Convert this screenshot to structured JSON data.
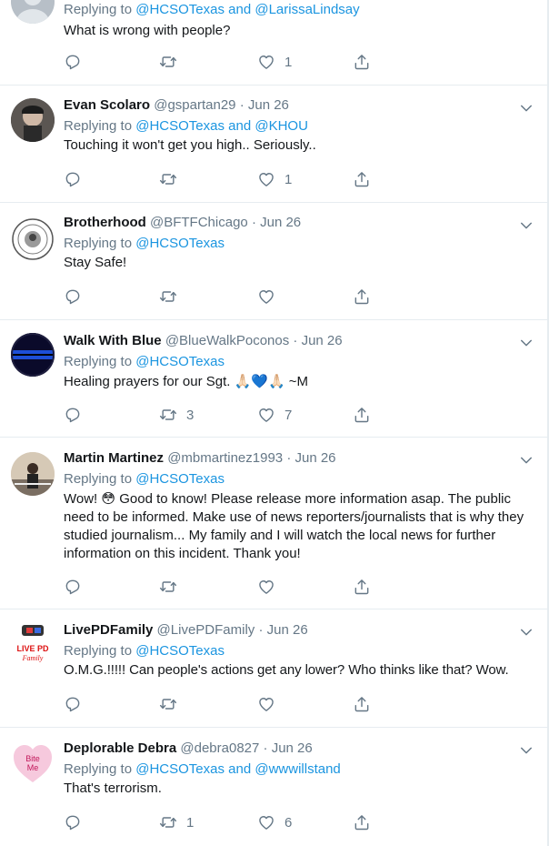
{
  "tweets": [
    {
      "name": "",
      "handle": "",
      "date": "",
      "reply_prefix": "Replying to",
      "reply_1": "@HCSOTexas",
      "reply_and": "and",
      "reply_2": "@LarissaLindsay",
      "text": "What is wrong with people?",
      "retweets": "",
      "likes": "1"
    },
    {
      "name": "Evan Scolaro",
      "handle": "@gspartan29",
      "sep": "·",
      "date": "Jun 26",
      "reply_prefix": "Replying to",
      "reply_1": "@HCSOTexas",
      "reply_and": "and",
      "reply_2": "@KHOU",
      "text": "Touching it won't get you high.. Seriously..",
      "retweets": "",
      "likes": "1"
    },
    {
      "name": "Brotherhood",
      "handle": "@BFTFChicago",
      "sep": "·",
      "date": "Jun 26",
      "reply_prefix": "Replying to",
      "reply_1": "@HCSOTexas",
      "text": "Stay Safe!",
      "retweets": "",
      "likes": ""
    },
    {
      "name": "Walk With Blue",
      "handle": "@BlueWalkPoconos",
      "sep": "·",
      "date": "Jun 26",
      "reply_prefix": "Replying to",
      "reply_1": "@HCSOTexas",
      "text_before": "Healing prayers for our Sgt.",
      "text_emoji": "🙏🏻💙🙏🏻",
      "text_after": "~M",
      "retweets": "3",
      "likes": "7"
    },
    {
      "name": "Martin Martinez",
      "handle": "@mbmartinez1993",
      "sep": "·",
      "date": "Jun 26",
      "reply_prefix": "Replying to",
      "reply_1": "@HCSOTexas",
      "text_before": "Wow!",
      "text_emoji": "😳",
      "text_after": "Good to know! Please release more information asap. The public need to be informed. Make use of news reporters/journalists that is why they studied journalism... My family and I will watch the local news for further information on this incident. Thank you!",
      "retweets": "",
      "likes": ""
    },
    {
      "name": "LivePDFamily",
      "handle": "@LivePDFamily",
      "sep": "·",
      "date": "Jun 26",
      "reply_prefix": "Replying to",
      "reply_1": "@HCSOTexas",
      "text": "O.M.G.!!!!! Can people's actions get any lower? Who thinks like that? Wow.",
      "retweets": "",
      "likes": "",
      "avatar_text_1": "LIVE PD",
      "avatar_text_2": "Family"
    },
    {
      "name": "Deplorable Debra",
      "handle": "@debra0827",
      "sep": "·",
      "date": "Jun 26",
      "reply_prefix": "Replying to",
      "reply_1": "@HCSOTexas",
      "reply_and": "and",
      "reply_2": "@wwwillstand",
      "text": "That's terrorism.",
      "retweets": "1",
      "likes": "6",
      "avatar_text_1": "Bite",
      "avatar_text_2": "Me"
    }
  ],
  "colors": {
    "link": "#1b95e0",
    "muted": "#657786",
    "text": "#14171a",
    "divider": "#e6ecf0"
  },
  "icons": [
    "reply-icon",
    "retweet-icon",
    "like-icon",
    "share-icon",
    "caret-down-icon"
  ]
}
